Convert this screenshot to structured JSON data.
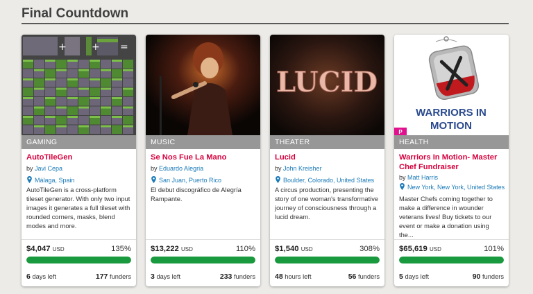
{
  "section": {
    "title": "Final Countdown"
  },
  "colors": {
    "accent": "#d6003d",
    "link": "#1a7ab8",
    "progress": "#1a9a3e",
    "category_bar": "#979797"
  },
  "cards": [
    {
      "category": "GAMING",
      "title": "AutoTileGen",
      "by": "by",
      "author": "Javi Cepa",
      "location": "Málaga, Spain",
      "blurb": "AutoTileGen is a cross-platform tileset generator. With only two input images it generates a full tileset with rounded corners, masks, blend modes and more.",
      "raised": "$4,047",
      "currency": "USD",
      "percent": "135%",
      "progress_fraction": 1.0,
      "time_value": "6",
      "time_label": "days left",
      "funders_count": "177",
      "funders_label": "funders"
    },
    {
      "category": "MUSIC",
      "title": "Se Nos Fue La Mano",
      "by": "by",
      "author": "Eduardo Alegria",
      "location": "San Juan, Puerto Rico",
      "blurb": "El debut discográfico de Alegría Rampante.",
      "raised": "$13,222",
      "currency": "USD",
      "percent": "110%",
      "progress_fraction": 1.0,
      "time_value": "3",
      "time_label": "days left",
      "funders_count": "233",
      "funders_label": "funders"
    },
    {
      "category": "THEATER",
      "title": "Lucid",
      "image_text": "LUCID",
      "by": "by",
      "author": "John Kreisher",
      "location": "Boulder, Colorado, United States",
      "blurb": "A circus production, presenting the story of one woman's transformative journey of consciousness through a lucid dream.",
      "raised": "$1,540",
      "currency": "USD",
      "percent": "308%",
      "progress_fraction": 1.0,
      "time_value": "48",
      "time_label": "hours left",
      "funders_count": "56",
      "funders_label": "funders"
    },
    {
      "category": "HEALTH",
      "title": "Warriors In Motion- Master Chef Fundraiser",
      "image_text_1": "WARRIORS IN",
      "image_text_2": "MOTION",
      "badge": "P",
      "by": "by",
      "author": "Matt Harris",
      "location": "New York, New York, United States",
      "blurb": "Master Chefs coming together to make a difference in wounder veterans lives! Buy tickets to our event or make a donation using the...",
      "raised": "$65,619",
      "currency": "USD",
      "percent": "101%",
      "progress_fraction": 1.0,
      "time_value": "5",
      "time_label": "days left",
      "funders_count": "90",
      "funders_label": "funders"
    }
  ]
}
